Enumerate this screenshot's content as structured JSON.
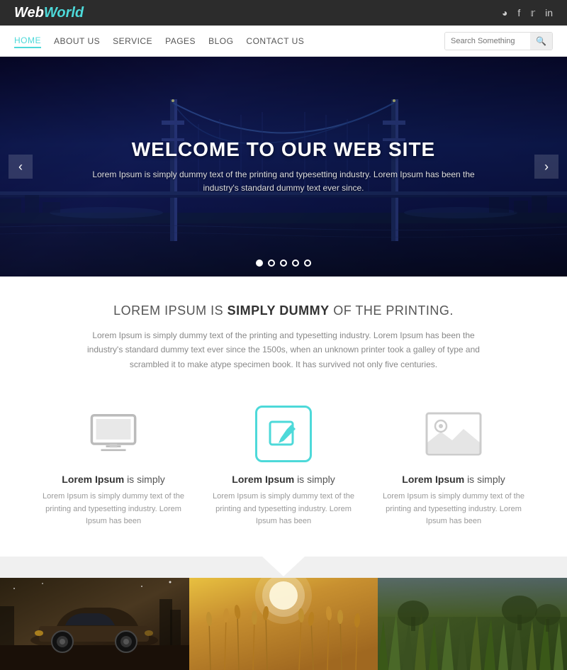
{
  "topbar": {
    "logo": {
      "web": "Web",
      "world": "World"
    },
    "social": [
      "rss",
      "f",
      "t",
      "in"
    ]
  },
  "nav": {
    "links": [
      {
        "label": "HOME",
        "active": true
      },
      {
        "label": "ABOUT US",
        "active": false
      },
      {
        "label": "SERVICE",
        "active": false
      },
      {
        "label": "PAGES",
        "active": false
      },
      {
        "label": "BLOG",
        "active": false
      },
      {
        "label": "CONTACT US",
        "active": false
      }
    ],
    "search_placeholder": "Search Something"
  },
  "hero": {
    "title": "WELCOME TO OUR WEB SITE",
    "subtitle": "Lorem Ipsum is simply dummy text of the printing and typesetting industry. Lorem Ipsum has been the\nindustry's standard dummy text ever since.",
    "dots": [
      true,
      false,
      false,
      false,
      false
    ]
  },
  "intro": {
    "heading_pre": "LOREM IPSUM IS ",
    "heading_bold": "SIMPLY DUMMY",
    "heading_post": " OF THE PRINTING.",
    "text": "Lorem Ipsum is simply dummy text of the printing and typesetting industry. Lorem Ipsum has been the industry's standard dummy text ever since the\n1500s, when an unknown printer took a galley of type and scrambled it to make atype specimen book.\nIt has survived not only five centuries."
  },
  "features": [
    {
      "type": "monitor",
      "title_bold": "Lorem Ipsum",
      "title_rest": " is simply",
      "desc": "Lorem Ipsum is simply dummy text of the printing and typesetting industry. Lorem Ipsum has been"
    },
    {
      "type": "edit",
      "title_bold": "Lorem Ipsum",
      "title_rest": " is simply",
      "desc": "Lorem Ipsum is simply dummy text of the printing and typesetting industry. Lorem Ipsum has been"
    },
    {
      "type": "image",
      "title_bold": "Lorem Ipsum",
      "title_rest": " is simply",
      "desc": "Lorem Ipsum is simply dummy text of the printing and typesetting industry. Lorem Ipsum has been"
    }
  ],
  "portfolio": [
    {
      "type": "car",
      "alt": "Vintage car"
    },
    {
      "type": "wheat",
      "alt": "Wheat field"
    },
    {
      "type": "grass",
      "alt": "Grass field"
    }
  ]
}
